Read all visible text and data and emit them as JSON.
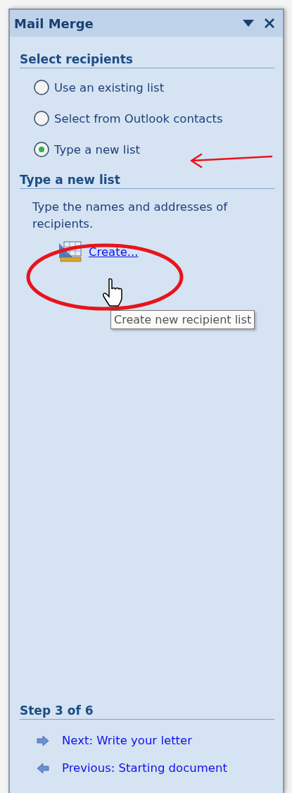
{
  "panel": {
    "title": "Mail Merge"
  },
  "select_recipients": {
    "heading": "Select recipients",
    "options": [
      {
        "label": "Use an existing list",
        "selected": false
      },
      {
        "label": "Select from Outlook contacts",
        "selected": false
      },
      {
        "label": "Type a new list",
        "selected": true
      }
    ]
  },
  "type_new_list": {
    "heading": "Type a new list",
    "description": "Type the names and addresses of recipients.",
    "link": "Create...",
    "tooltip": "Create new recipient list"
  },
  "step": {
    "heading": "Step 3 of 6",
    "links": [
      {
        "kind": "next",
        "label": "Next: Write your letter"
      },
      {
        "kind": "previous",
        "label": "Previous: Starting document"
      }
    ]
  }
}
